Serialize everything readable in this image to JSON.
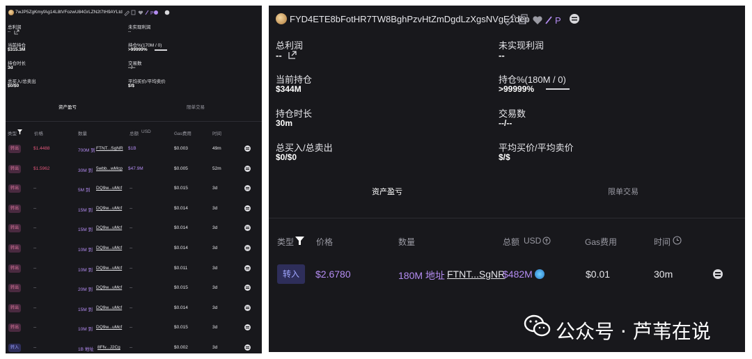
{
  "left": {
    "address": "7wJP5ZgKmyfAg14L8tVFozwU84GrLZN2t7tH9AYLtd",
    "stats": {
      "total_profit_label": "总利润",
      "total_profit_value": "--",
      "unrealized_label": "未实现利润",
      "unrealized_value": "--",
      "holding_label": "当前持仓",
      "holding_value": "$315.3M",
      "holding_pct_label": "持仓%(170M / 0)",
      "holding_pct_value": ">99999%",
      "duration_label": "持仓时长",
      "duration_value": "3d",
      "trades_label": "交易数",
      "trades_value": "--/--",
      "buy_sell_label": "总买入/总卖出",
      "buy_sell_value": "$0/$0",
      "avg_label": "平均买价/平均卖价",
      "avg_value": "$/$"
    },
    "tabs": [
      "资产盈亏",
      "限单交易"
    ],
    "headers": [
      "类型",
      "价格",
      "数量",
      "总额",
      "USD",
      "Gas费用",
      "时间"
    ],
    "rows": [
      {
        "type": "转出",
        "price": "$1.4488",
        "amount": "700M 到",
        "addr": "FTNT...SgNR",
        "total": "$1B",
        "gas": "$0.003",
        "time": "49m"
      },
      {
        "type": "转出",
        "price": "$1.5962",
        "amount": "30M 到",
        "addr": "5wbb...wMcp",
        "total": "$47.9M",
        "gas": "$0.005",
        "time": "52m"
      },
      {
        "type": "转出",
        "price": "--",
        "amount": "5M 到",
        "addr": "DQ9w...uMcf",
        "total": "--",
        "gas": "$0.015",
        "time": "3d"
      },
      {
        "type": "转出",
        "price": "--",
        "amount": "15M 到",
        "addr": "DQ9w...uMcf",
        "total": "--",
        "gas": "$0.014",
        "time": "3d"
      },
      {
        "type": "转出",
        "price": "--",
        "amount": "15M 到",
        "addr": "DQ9w...uMcf",
        "total": "--",
        "gas": "$0.014",
        "time": "3d"
      },
      {
        "type": "转出",
        "price": "--",
        "amount": "10M 到",
        "addr": "DQ9w...uMcf",
        "total": "--",
        "gas": "$0.014",
        "time": "3d"
      },
      {
        "type": "转出",
        "price": "--",
        "amount": "10M 到",
        "addr": "DQ9w...uMcf",
        "total": "--",
        "gas": "$0.011",
        "time": "3d"
      },
      {
        "type": "转出",
        "price": "--",
        "amount": "20M 到",
        "addr": "DQ9w...uMcf",
        "total": "--",
        "gas": "$0.015",
        "time": "3d"
      },
      {
        "type": "转出",
        "price": "--",
        "amount": "15M 到",
        "addr": "DQ9w...uMcf",
        "total": "--",
        "gas": "$0.014",
        "time": "3d"
      },
      {
        "type": "转出",
        "price": "--",
        "amount": "10M 到",
        "addr": "DQ9w...uMcf",
        "total": "--",
        "gas": "$0.015",
        "time": "3d"
      },
      {
        "type": "转入",
        "price": "--",
        "amount": "1B 地址",
        "addr": "8Ffv...J2Cg",
        "total": "--",
        "gas": "$0.002",
        "time": "3d"
      }
    ]
  },
  "right": {
    "address": "FYD4ETE8bFotHR7TW8BghPzvHtZmDgdLzXgsNVgE1dep",
    "letter": "P",
    "stats": {
      "total_profit_label": "总利润",
      "total_profit_value": "--",
      "unrealized_label": "未实现利润",
      "unrealized_value": "--",
      "holding_label": "当前持仓",
      "holding_value": "$344M",
      "holding_pct_label": "持仓%(180M / 0)",
      "holding_pct_value": ">99999%",
      "duration_label": "持仓时长",
      "duration_value": "30m",
      "trades_label": "交易数",
      "trades_value": "--/--",
      "buy_sell_label": "总买入/总卖出",
      "buy_sell_value": "$0/$0",
      "avg_label": "平均买价/平均卖价",
      "avg_value": "$/$"
    },
    "tabs": [
      "资产盈亏",
      "限单交易"
    ],
    "headers": [
      "类型",
      "价格",
      "数量",
      "总额",
      "USD",
      "Gas费用",
      "时间"
    ],
    "row": {
      "type": "转入",
      "price": "$2.6780",
      "amount": "180M 地址",
      "addr": "FTNT...SgNR",
      "total": "$482M",
      "gas": "$0.01",
      "time": "30m"
    }
  },
  "watermark": "公众号 · 芦苇在说",
  "colors": {
    "panel_bg": "#18181c",
    "accent_purple": "#b48cf2",
    "sell_red": "#e0567a",
    "buy_blue": "#a0a6ff"
  }
}
